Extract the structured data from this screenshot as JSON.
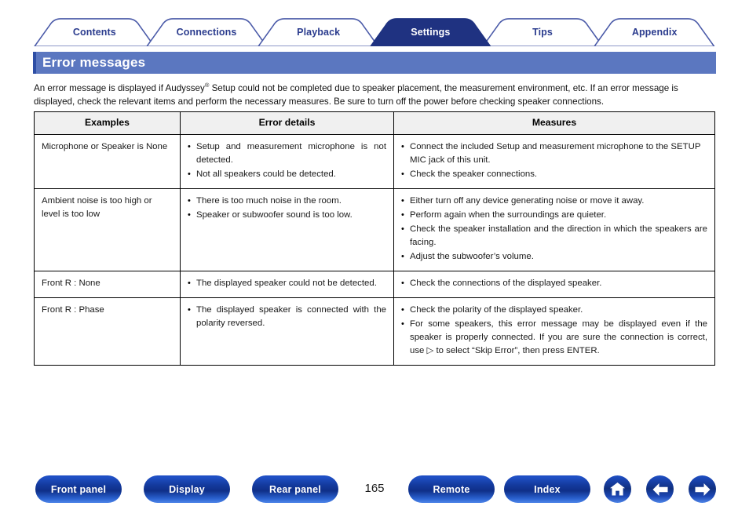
{
  "tabs": [
    {
      "label": "Contents",
      "active": false
    },
    {
      "label": "Connections",
      "active": false
    },
    {
      "label": "Playback",
      "active": false
    },
    {
      "label": "Settings",
      "active": true
    },
    {
      "label": "Tips",
      "active": false
    },
    {
      "label": "Appendix",
      "active": false
    }
  ],
  "page": {
    "title": "Error messages",
    "intro": "An error message is displayed if Audyssey® Setup could not be completed due to speaker placement, the measurement environment, etc. If an error message is displayed, check the relevant items and perform the necessary measures. Be sure to turn off the power before checking speaker connections.",
    "intro_part1": "An error message is displayed if Audyssey",
    "intro_sup": "®",
    "intro_part2": " Setup could not be completed due to speaker placement, the measurement environment, etc. If an error message is displayed, check the relevant items and perform the necessary measures. Be sure to turn off the power before checking speaker connections.",
    "number": "165"
  },
  "table": {
    "headers": [
      "Examples",
      "Error details",
      "Measures"
    ],
    "rows": [
      {
        "example": "Microphone or Speaker is None",
        "details": [
          "Setup and measurement microphone is not detected.",
          "Not all speakers could be detected."
        ],
        "measures": [
          "Connect the included Setup and measurement microphone to the SETUP MIC jack of this unit.",
          "Check the speaker connections."
        ]
      },
      {
        "example": "Ambient noise is too high or level is too low",
        "details": [
          "There is too much noise in the room.",
          "Speaker or subwoofer sound is too low."
        ],
        "measures": [
          "Either turn off any device generating noise or move it away.",
          "Perform again when the surroundings are quieter.",
          "Check the speaker installation and the direction in which the speakers are facing.",
          "Adjust the subwoofer’s volume."
        ]
      },
      {
        "example": "Front R : None",
        "details": [
          "The displayed speaker could not be detected."
        ],
        "measures": [
          "Check the connections of the displayed speaker."
        ]
      },
      {
        "example": "Front R : Phase",
        "details": [
          "The displayed speaker is connected with the polarity reversed."
        ],
        "measures": [
          "Check the polarity of the displayed speaker.",
          "For some speakers, this error message may be displayed even if the speaker is properly connected. If you are sure the connection is correct, use ▷ to select “Skip Error”, then press ENTER."
        ]
      }
    ]
  },
  "bottom_nav": {
    "buttons": [
      {
        "label": "Front panel"
      },
      {
        "label": "Display"
      },
      {
        "label": "Rear panel"
      },
      {
        "label": "Remote"
      },
      {
        "label": "Index"
      }
    ],
    "icons": [
      {
        "name": "home-icon"
      },
      {
        "name": "arrow-left-icon"
      },
      {
        "name": "arrow-right-icon"
      }
    ]
  },
  "colors": {
    "tab_text": "#2b3c8e",
    "tab_active_bg": "#1f3281",
    "title_banner": "#5b77c0",
    "underline": "#1f3281",
    "button_blue": "#11307f",
    "table_header_bg": "#f0f0f0"
  }
}
